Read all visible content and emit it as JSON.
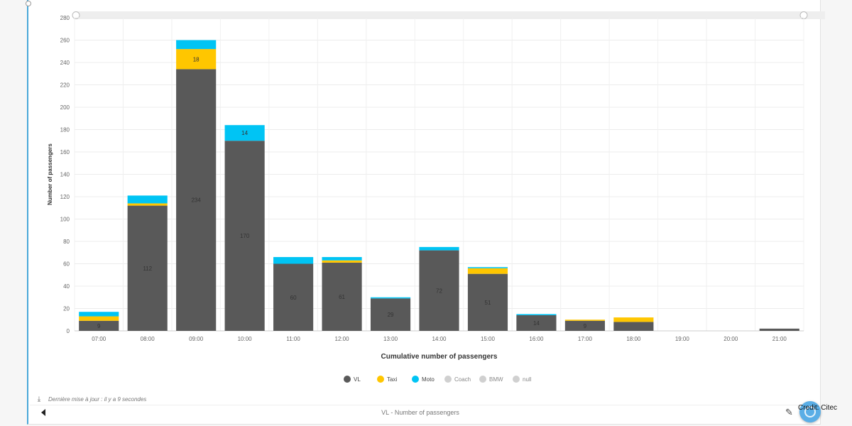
{
  "chart_data": {
    "type": "bar",
    "stacked": true,
    "xlabel": "Cumulative number of passengers",
    "ylabel": "Number of passengers",
    "ylim": [
      0,
      280
    ],
    "yticks": [
      0,
      20,
      40,
      60,
      80,
      100,
      120,
      140,
      160,
      180,
      200,
      220,
      240,
      260,
      280
    ],
    "grid": true,
    "legend_position": "bottom",
    "categories": [
      "07:00",
      "08:00",
      "09:00",
      "10:00",
      "11:00",
      "12:00",
      "13:00",
      "14:00",
      "15:00",
      "16:00",
      "17:00",
      "18:00",
      "19:00",
      "20:00",
      "21:00"
    ],
    "series": [
      {
        "name": "VL",
        "color": "#595959",
        "values": [
          9,
          112,
          234,
          170,
          60,
          61,
          29,
          72,
          51,
          14,
          9,
          8,
          0,
          0,
          2
        ],
        "visible": true
      },
      {
        "name": "Taxi",
        "color": "#ffc600",
        "values": [
          4,
          2,
          18,
          0,
          0,
          2,
          0,
          0,
          5,
          0,
          1,
          4,
          0,
          0,
          0
        ],
        "visible": true
      },
      {
        "name": "Moto",
        "color": "#00c4f4",
        "values": [
          4,
          7,
          8,
          14,
          6,
          3,
          1,
          3,
          1,
          1,
          0,
          0,
          0,
          0,
          0
        ],
        "visible": true
      },
      {
        "name": "Coach",
        "color": "#d0d0d0",
        "values": [
          0,
          0,
          0,
          0,
          0,
          0,
          0,
          0,
          0,
          0,
          0,
          0,
          0,
          0,
          0
        ],
        "visible": false
      },
      {
        "name": "BMW",
        "color": "#d0d0d0",
        "values": [
          0,
          0,
          0,
          0,
          0,
          0,
          0,
          0,
          0,
          0,
          0,
          0,
          0,
          0,
          0
        ],
        "visible": false
      },
      {
        "name": "null",
        "color": "#d0d0d0",
        "values": [
          0,
          0,
          0,
          0,
          0,
          0,
          0,
          0,
          0,
          0,
          0,
          0,
          0,
          0,
          0
        ],
        "visible": false
      }
    ],
    "data_labels": [
      {
        "category": "07:00",
        "series": "VL",
        "text": "9"
      },
      {
        "category": "08:00",
        "series": "VL",
        "text": "112"
      },
      {
        "category": "09:00",
        "series": "VL",
        "text": "234"
      },
      {
        "category": "09:00",
        "series": "Taxi",
        "text": "18"
      },
      {
        "category": "10:00",
        "series": "VL",
        "text": "170"
      },
      {
        "category": "10:00",
        "series": "Moto",
        "text": "14"
      },
      {
        "category": "11:00",
        "series": "VL",
        "text": "60"
      },
      {
        "category": "12:00",
        "series": "VL",
        "text": "61"
      },
      {
        "category": "13:00",
        "series": "VL",
        "text": "29"
      },
      {
        "category": "14:00",
        "series": "VL",
        "text": "72"
      },
      {
        "category": "15:00",
        "series": "VL",
        "text": "51"
      },
      {
        "category": "16:00",
        "series": "VL",
        "text": "14"
      },
      {
        "category": "17:00",
        "series": "VL",
        "text": "9"
      }
    ]
  },
  "footer": {
    "last_update": "Dernière mise à jour : il y a 9 secondes",
    "series_title": "VL - Number of passengers"
  },
  "credit": "Credit: Citec",
  "icons": {
    "download": "download-icon",
    "edit": "pencil-icon",
    "nav_prev": "chevron-left-icon",
    "scroll_handle": "scroll-handle-icon"
  }
}
